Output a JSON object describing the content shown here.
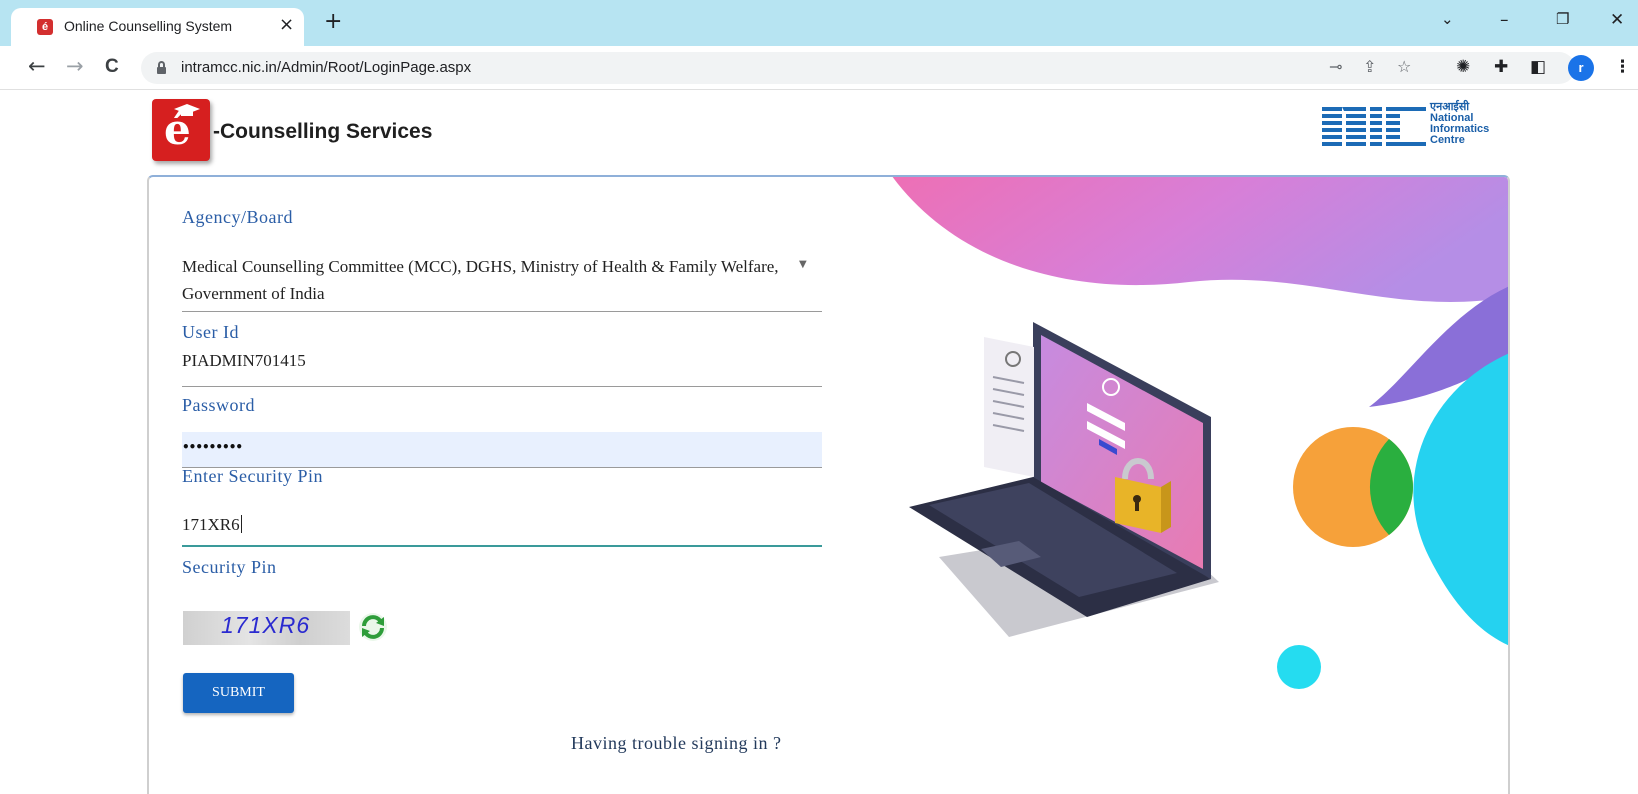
{
  "browser": {
    "tab_title": "Online Counselling System",
    "tab_close": "×",
    "new_tab": "+",
    "url": "intramcc.nic.in/Admin/Root/LoginPage.aspx",
    "profile_initial": "r",
    "window_controls": {
      "dropdown": "⌄",
      "minimize": "–",
      "restore": "❐",
      "close": "✕"
    },
    "nav": {
      "back": "←",
      "forward": "→",
      "reload": "C"
    },
    "icons": [
      "key-icon",
      "share-icon",
      "star-icon",
      "extension-icon",
      "puzzle-icon",
      "sidebar-icon",
      "menu-icon"
    ]
  },
  "header": {
    "brand_title": "-Counselling Services",
    "logo_letter": "é",
    "nic_lines": [
      "एनआईसी",
      "National",
      "Informatics",
      "Centre"
    ]
  },
  "form": {
    "agency_label": "Agency/Board",
    "agency_value": "Medical Counselling Committee (MCC), DGHS, Ministry of Health & Family Welfare, Government of India",
    "userid_label": "User Id",
    "userid_value": "PIADMIN701415",
    "password_label": "Password",
    "password_value": "•••••••••",
    "pin_label": "Enter Security Pin",
    "pin_value": "171XR6",
    "captcha_label": "Security Pin",
    "captcha_text": "171XR6",
    "submit_label": "SUBMIT",
    "trouble_link": "Having trouble signing in ?"
  },
  "colors": {
    "accent": "#1565c0",
    "label": "#2a5da6",
    "tabstrip": "#b7e4f2",
    "pin_focus": "#3a9a9a"
  }
}
